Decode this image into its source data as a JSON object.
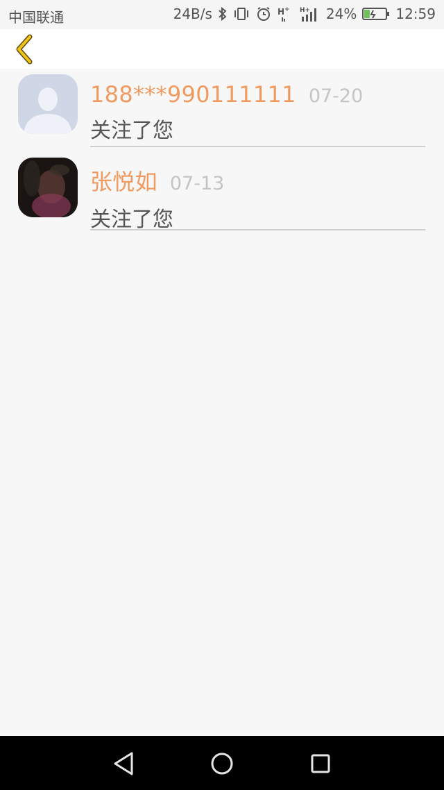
{
  "status_bar": {
    "carrier": "中国联通",
    "speed": "24B/s",
    "battery_percent": "24%",
    "time": "12:59",
    "icons": [
      "bluetooth-icon",
      "vibrate-icon",
      "alarm-icon",
      "signal-h-plus-icon",
      "signal-h-plus-icon",
      "battery-icon"
    ]
  },
  "header": {
    "back_icon": "chevron-left-icon",
    "accent_color": "#f0c419"
  },
  "notifications": [
    {
      "name": "188***990111111",
      "date": "07-20",
      "message": "关注了您",
      "avatar": "default-avatar"
    },
    {
      "name": "张悦如",
      "date": "07-13",
      "message": "关注了您",
      "avatar": "photo-avatar"
    }
  ],
  "nav_bar": {
    "buttons": [
      "back-triangle-icon",
      "home-circle-icon",
      "recents-square-icon"
    ]
  },
  "colors": {
    "name": "#f19a5f",
    "date": "#c4c4c4",
    "message": "#555555",
    "background": "#f7f7f7"
  }
}
